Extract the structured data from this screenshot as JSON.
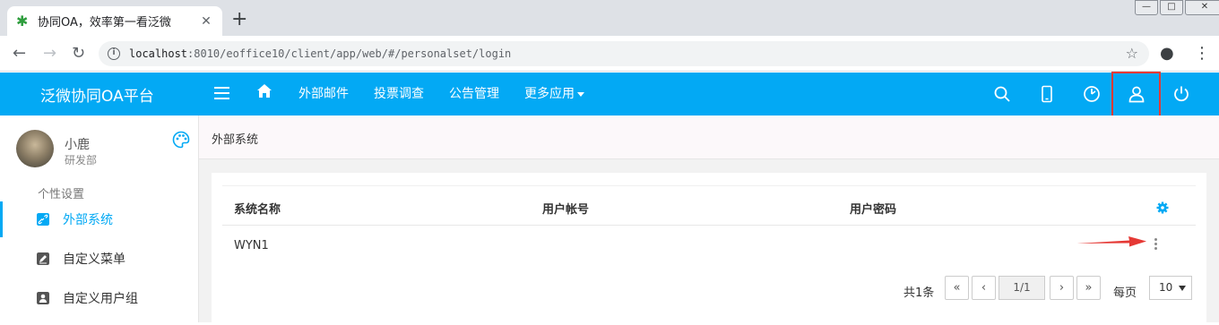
{
  "browser": {
    "tab_title": "协同OA，效率第一看泛微",
    "tab_close": "✕",
    "new_tab": "+",
    "url_host": "localhost",
    "url_rest": ":8010/eoffice10/client/app/web/#/personalset/login",
    "win_min": "—",
    "win_max": "□",
    "win_close": "✕"
  },
  "app": {
    "title": "泛微协同OA平台",
    "nav": [
      "外部邮件",
      "投票调查",
      "公告管理",
      "更多应用"
    ],
    "accent": "#03a9f4",
    "highlight": "#e53935"
  },
  "sidebar": {
    "user_name": "小鹿",
    "user_dept": "研发部",
    "section": "个性设置",
    "items": [
      {
        "label": "外部系统",
        "icon": "link-icon",
        "active": true
      },
      {
        "label": "自定义菜单",
        "icon": "edit-menu-icon",
        "active": false
      },
      {
        "label": "自定义用户组",
        "icon": "user-group-icon",
        "active": false
      }
    ]
  },
  "main": {
    "breadcrumb": "外部系统",
    "table": {
      "columns": [
        "系统名称",
        "用户帐号",
        "用户密码"
      ],
      "rows": [
        {
          "name": "WYN1",
          "account": "",
          "password": ""
        }
      ]
    },
    "pager": {
      "total": "共1条",
      "first": "«",
      "prev": "‹",
      "current": "1/1",
      "next": "›",
      "last": "»",
      "per_page_label": "每页",
      "per_page": "10"
    }
  }
}
